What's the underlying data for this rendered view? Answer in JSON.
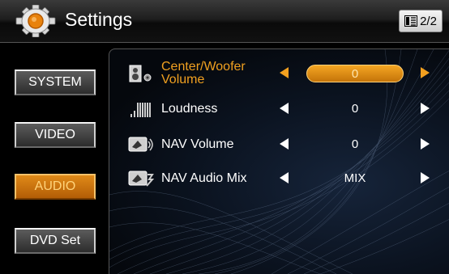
{
  "header": {
    "title": "Settings",
    "page_indicator": "2/2"
  },
  "sidebar": {
    "items": [
      {
        "label": "SYSTEM",
        "active": false
      },
      {
        "label": "VIDEO",
        "active": false
      },
      {
        "label": "AUDIO",
        "active": true
      },
      {
        "label": "DVD Set",
        "active": false
      }
    ]
  },
  "settings": [
    {
      "label": "Center/Woofer Volume",
      "value": "0",
      "selected": true,
      "icon": "speaker-icon"
    },
    {
      "label": "Loudness",
      "value": "0",
      "selected": false,
      "icon": "equalizer-icon"
    },
    {
      "label": "NAV Volume",
      "value": "0",
      "selected": false,
      "icon": "nav-volume-icon"
    },
    {
      "label": "NAV Audio Mix",
      "value": "MIX",
      "selected": false,
      "icon": "nav-mix-icon"
    }
  ],
  "colors": {
    "accent": "#f0a020",
    "background": "#000000"
  }
}
